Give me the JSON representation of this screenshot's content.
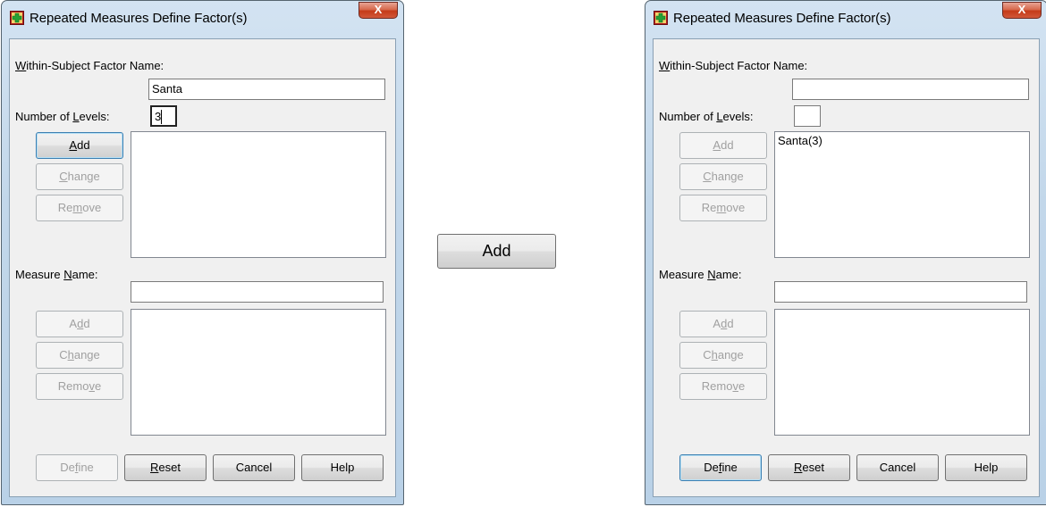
{
  "window_title": "Repeated Measures Define Factor(s)",
  "close_glyph": "X",
  "middle_button_label": "Add",
  "labels": {
    "factor_name_pre": "",
    "factor_name_u": "W",
    "factor_name_post": "ithin-Subject Factor Name:",
    "levels_pre": "Number of ",
    "levels_u": "L",
    "levels_post": "evels:",
    "measure_pre": "Measure ",
    "measure_u": "N",
    "measure_post": "ame:"
  },
  "buttons": {
    "add1_pre": "",
    "add1_u": "A",
    "add1_post": "dd",
    "change1_pre": "",
    "change1_u": "C",
    "change1_post": "hange",
    "remove1_pre": "Re",
    "remove1_u": "m",
    "remove1_post": "ove",
    "add2_pre": "A",
    "add2_u": "d",
    "add2_post": "d",
    "change2_pre": "C",
    "change2_u": "h",
    "change2_post": "ange",
    "remove2_pre": "Remo",
    "remove2_u": "v",
    "remove2_post": "e",
    "define_pre": "De",
    "define_u": "f",
    "define_post": "ine",
    "reset_pre": "",
    "reset_u": "R",
    "reset_post": "eset",
    "cancel": "Cancel",
    "help": "Help"
  },
  "left_dialog": {
    "factor_name_value": "Santa",
    "levels_value": "3",
    "factor_list": [],
    "measure_name_value": "",
    "measure_list": []
  },
  "right_dialog": {
    "factor_name_value": "",
    "levels_value": "",
    "factor_list": [
      "Santa(3)"
    ],
    "measure_name_value": "",
    "measure_list": []
  },
  "colors": {
    "frame": "#c2d7ea",
    "client": "#f0f0f0",
    "close": "#c53b19"
  },
  "icons": [
    "spss-app-icon",
    "close-icon"
  ]
}
